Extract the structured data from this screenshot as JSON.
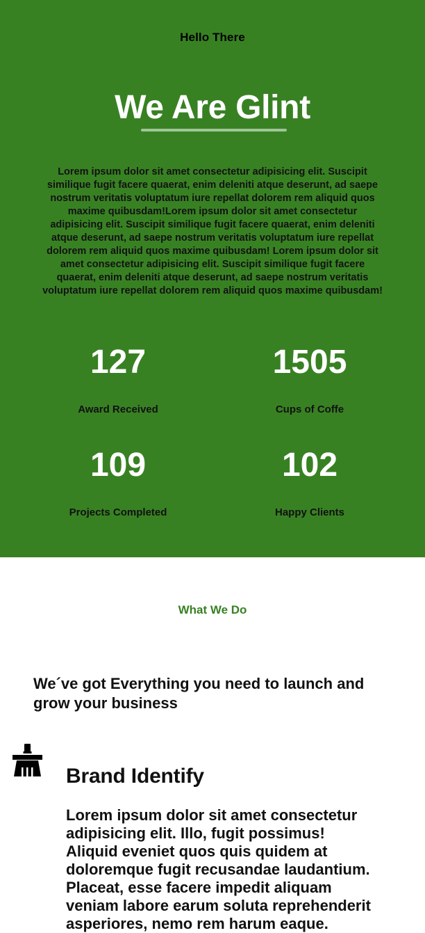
{
  "hero": {
    "eyebrow": "Hello There",
    "title": "We Are Glint",
    "copy": "Lorem ipsum dolor sit amet consectetur adipisicing elit. Suscipit similique fugit facere quaerat, enim deleniti atque deserunt, ad saepe nostrum veritatis voluptatum iure repellat dolorem rem aliquid quos maxime quibusdam!Lorem ipsum dolor sit amet consectetur adipisicing elit. Suscipit similique fugit facere quaerat, enim deleniti atque deserunt, ad saepe nostrum veritatis voluptatum iure repellat dolorem rem aliquid quos maxime quibusdam! Lorem ipsum dolor sit amet consectetur adipisicing elit. Suscipit similique fugit facere quaerat, enim deleniti atque deserunt, ad saepe nostrum veritatis voluptatum iure repellat dolorem rem aliquid quos maxime quibusdam!",
    "background_color": "#388123"
  },
  "stats": [
    {
      "value": "127",
      "label": "Award Received"
    },
    {
      "value": "1505",
      "label": "Cups of Coffe"
    },
    {
      "value": "109",
      "label": "Projects Completed"
    },
    {
      "value": "102",
      "label": "Happy Clients"
    }
  ],
  "what_we_do": {
    "kicker": "What We Do",
    "heading": "We´ve got Everything you need to launch and grow your business",
    "accent_color": "#388123"
  },
  "service": {
    "icon": "brush-icon",
    "title": "Brand Identify",
    "copy": "Lorem ipsum dolor sit amet consectetur adipisicing elit. Illo, fugit possimus! Aliquid eveniet quos quis quidem at doloremque fugit recusandae laudantium. Placeat, esse facere impedit aliquam veniam labore earum soluta reprehenderit asperiores, nemo rem harum eaque."
  }
}
